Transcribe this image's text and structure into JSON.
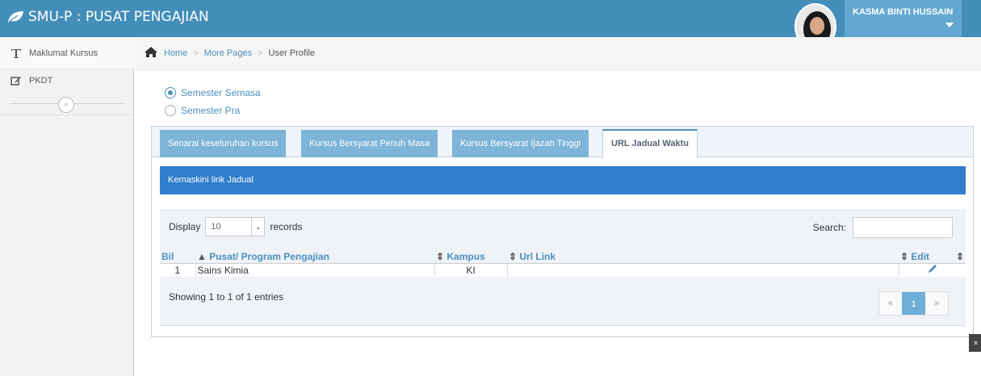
{
  "app": {
    "title": "SMU-P : PUSAT PENGAJIAN",
    "accent": "#438eb9"
  },
  "user": {
    "name": "KASMA BINTI HUSSAIN"
  },
  "sidebar": {
    "items": [
      {
        "label": "Maklumat Kursus",
        "icon": "text-icon"
      },
      {
        "label": "PKDT",
        "icon": "edit-icon"
      }
    ],
    "collapse_glyph": "«"
  },
  "breadcrumb": {
    "home": "Home",
    "more": "More Pages",
    "current": "User Profile",
    "sep": ">"
  },
  "radios": [
    {
      "label": "Semester Semasa",
      "checked": true
    },
    {
      "label": "Semester Pra",
      "checked": false
    }
  ],
  "tabs": [
    {
      "label": "Senarai keseluruhan kursus"
    },
    {
      "label": "Kursus Bersyarat Penuh Masa"
    },
    {
      "label": "Kursus Bersyarat Ijazah Tinggi"
    },
    {
      "label": "URL Jadual Waktu",
      "active": true
    }
  ],
  "widget": {
    "title": "Kemaskini link Jadual"
  },
  "datatable": {
    "display_label": "Display",
    "length_value": "10",
    "records_label": "records",
    "search_label": "Search:",
    "columns": [
      "Bil",
      "Pusat/ Program Pengajian",
      "Kampus",
      "Url Link",
      "Edit"
    ],
    "rows": [
      {
        "bil": "1",
        "program": "Sains Kimia",
        "kampus": "KI",
        "url": ""
      }
    ],
    "info": "Showing 1 to 1 of 1 entries",
    "pager": {
      "prev": "«",
      "page": "1",
      "next": "»"
    }
  },
  "scroll_top_glyph": "«"
}
